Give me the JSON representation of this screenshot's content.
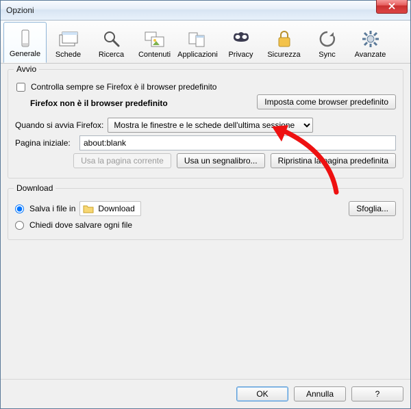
{
  "window": {
    "title": "Opzioni"
  },
  "toolbar": {
    "items": [
      {
        "label": "Generale"
      },
      {
        "label": "Schede"
      },
      {
        "label": "Ricerca"
      },
      {
        "label": "Contenuti"
      },
      {
        "label": "Applicazioni"
      },
      {
        "label": "Privacy"
      },
      {
        "label": "Sicurezza"
      },
      {
        "label": "Sync"
      },
      {
        "label": "Avanzate"
      }
    ]
  },
  "startup": {
    "group_label": "Avvio",
    "check_default_label": "Controlla sempre se Firefox è il browser predefinito",
    "status_text": "Firefox non è il browser predefinito",
    "set_default_label": "Imposta come browser predefinito",
    "when_start_label": "Quando si avvia Firefox:",
    "when_start_value": "Mostra le finestre e le schede dell'ultima sessione",
    "homepage_label": "Pagina iniziale:",
    "homepage_value": "about:blank",
    "use_current_label": "Usa la pagina corrente",
    "use_bookmark_label": "Usa un segnalibro...",
    "restore_label": "Ripristina la pagina predefinita"
  },
  "download": {
    "group_label": "Download",
    "save_to_label": "Salva i file in",
    "folder_name": "Download",
    "browse_label": "Sfoglia...",
    "ask_label": "Chiedi dove salvare ogni file"
  },
  "footer": {
    "ok": "OK",
    "cancel": "Annulla",
    "help": "?"
  }
}
